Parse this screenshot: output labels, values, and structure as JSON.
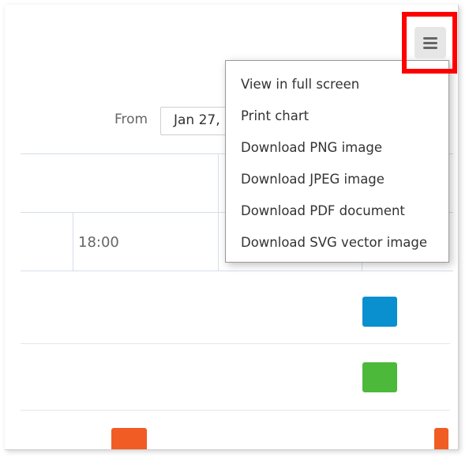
{
  "date_range": {
    "from_label": "From",
    "from_value": "Jan 27,"
  },
  "chart": {
    "time_label": "18:00",
    "marks": [
      {
        "name": "blue-bar",
        "color": "#0a8fcf"
      },
      {
        "name": "green-bar",
        "color": "#4cb93b"
      },
      {
        "name": "orange-bar-left",
        "color": "#f05c23"
      },
      {
        "name": "orange-bar-right",
        "color": "#f05c23"
      }
    ]
  },
  "context_menu": {
    "button_icon": "hamburger-menu-icon",
    "items": [
      {
        "label": "View in full screen"
      },
      {
        "label": "Print chart"
      },
      {
        "label": "Download PNG image"
      },
      {
        "label": "Download JPEG image"
      },
      {
        "label": "Download PDF document"
      },
      {
        "label": "Download SVG vector image"
      }
    ]
  },
  "annotation": {
    "highlight_color": "#ff0000"
  }
}
